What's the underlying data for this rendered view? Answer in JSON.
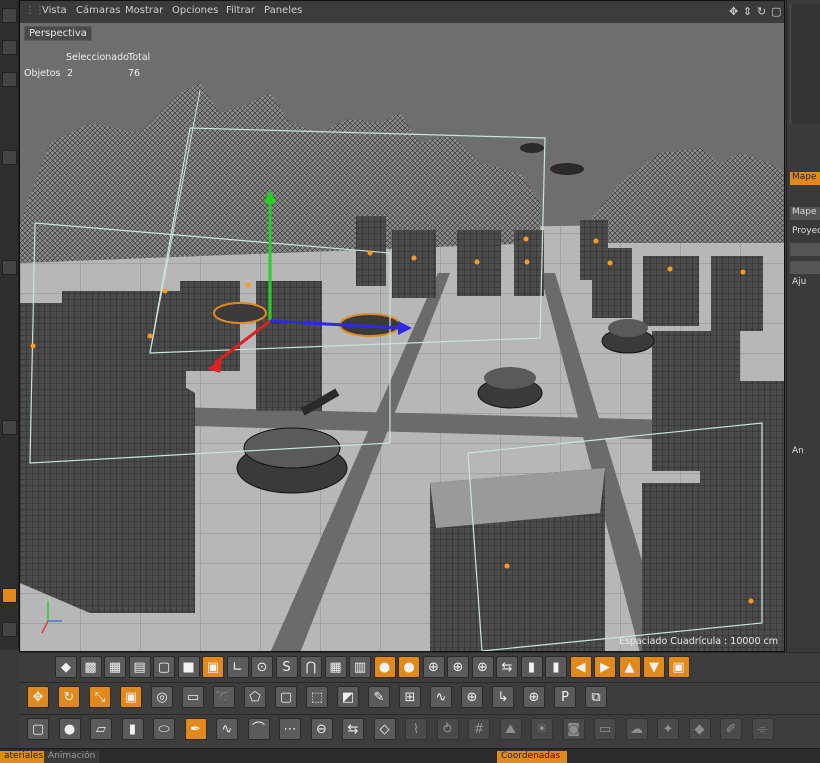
{
  "viewport": {
    "menu": [
      "Vista",
      "Cámaras",
      "Mostrar",
      "Opciones",
      "Filtrar",
      "Paneles"
    ],
    "label": "Perspectiva",
    "hud": {
      "col_selected": "Seleccionado",
      "col_total": "Total",
      "row_label": "Objetos",
      "selected": "2",
      "total": "76"
    },
    "grid_spacing": "Espaciado Cuadrícula : 10000 cm",
    "nav_icons": [
      "move-view-icon",
      "vertical-arrows-icon",
      "rotate-view-icon",
      "maximize-icon"
    ]
  },
  "right_panel": {
    "tab_1": "Mape",
    "tab_2": "Mape",
    "item_proyec": "Proyec",
    "item_aju": "Aju",
    "item_an": "An"
  },
  "toolbars": {
    "row1": [
      "materials-icon",
      "polygons-icon",
      "checker-icon",
      "edges-icon",
      "cube-icon",
      "box-icon",
      "cube-orange-icon",
      "angle-icon",
      "mouse-icon",
      "snap-s-icon",
      "snap-magnet-icon",
      "texture-icon",
      "uvw-icon",
      "sphere-orange-icon",
      "sphere-orange-icon",
      "globe-icon",
      "globe-icon",
      "globe-icon",
      "symmetry-icon",
      "split-icon",
      "split-icon",
      "arrow-left-icon",
      "arrow-right-icon",
      "arrow-up-icon",
      "arrow-down-icon",
      "cube-orange-icon"
    ],
    "row2": [
      "move-icon",
      "rotate-icon",
      "scale-icon",
      "scale-box-icon",
      "live-select-icon",
      "rect-select-icon",
      "lasso-select-icon",
      "poly-select-icon",
      "cube-icon",
      "extrude-icon",
      "bevel-icon",
      "knife-icon",
      "bridge-icon",
      "spline-icon",
      "weld-icon",
      "axis-icon",
      "world-icon",
      "psr-icon",
      "snap-icon"
    ],
    "row3": [
      "cube-icon",
      "sphere-icon",
      "plane-icon",
      "cylinder-icon",
      "disc-icon",
      "spline-pen-icon",
      "spline-icon",
      "nurbs-icon",
      "array-icon",
      "boole-icon",
      "symmetry-icon",
      "deformer-icon",
      "bend-icon",
      "twist-icon",
      "lattice-icon",
      "landscape-icon",
      "light-icon",
      "camera-icon",
      "floor-icon",
      "sky-icon",
      "effector-icon",
      "tag-icon",
      "paint-icon",
      "brush-icon"
    ]
  },
  "bottom_tabs": {
    "materials": "ateriales",
    "animation": "Animación",
    "coordinates": "Coordenadas"
  },
  "colors": {
    "accent": "#e08a1d",
    "viewport_bg": "#6a6a6a",
    "panel_bg": "#3a3a3a"
  }
}
